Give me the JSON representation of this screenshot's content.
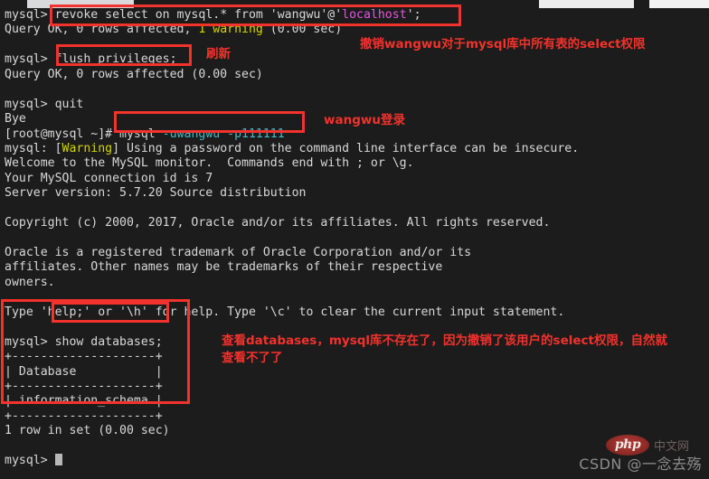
{
  "window": {
    "background_color": "#1c1c1c",
    "foreground_color": "#d6d6d6"
  },
  "terminal": {
    "prompt_mysql": "mysql> ",
    "prompt_shell": "[root@mysql ~]# ",
    "lines": [
      {
        "id": "l01",
        "prompt": "mysql> ",
        "segments": [
          {
            "text": "revoke select on mysql.* from 'wangwu'@'",
            "color": "white"
          },
          {
            "text": "localhost",
            "color": "magenta"
          },
          {
            "text": "';",
            "color": "white"
          }
        ]
      },
      {
        "id": "l02",
        "prompt": "",
        "segments": [
          {
            "text": "Query OK, 0 rows affected, ",
            "color": "white"
          },
          {
            "text": "1 warning",
            "color": "yellow"
          },
          {
            "text": " (0.00 sec)",
            "color": "white"
          }
        ]
      },
      {
        "id": "l03",
        "prompt": "",
        "segments": [
          {
            "text": "",
            "color": "white"
          }
        ]
      },
      {
        "id": "l04",
        "prompt": "mysql> ",
        "segments": [
          {
            "text": "flush privileges;",
            "color": "white"
          }
        ]
      },
      {
        "id": "l05",
        "prompt": "",
        "segments": [
          {
            "text": "Query OK, 0 rows affected (0.00 sec)",
            "color": "white"
          }
        ]
      },
      {
        "id": "l06",
        "prompt": "",
        "segments": [
          {
            "text": "",
            "color": "white"
          }
        ]
      },
      {
        "id": "l07",
        "prompt": "mysql> ",
        "segments": [
          {
            "text": "quit",
            "color": "white"
          }
        ]
      },
      {
        "id": "l08",
        "prompt": "",
        "segments": [
          {
            "text": "Bye",
            "color": "white"
          }
        ]
      },
      {
        "id": "l09",
        "prompt": "[root@mysql ~]# ",
        "segments": [
          {
            "text": "mysql ",
            "color": "white"
          },
          {
            "text": "-uwangwu -p111111",
            "color": "cyan"
          }
        ]
      },
      {
        "id": "l10",
        "prompt": "",
        "segments": [
          {
            "text": "mysql: [",
            "color": "white"
          },
          {
            "text": "Warning",
            "color": "yellow"
          },
          {
            "text": "] Using a password on the command line interface can be insecure.",
            "color": "white"
          }
        ]
      },
      {
        "id": "l11",
        "prompt": "",
        "segments": [
          {
            "text": "Welcome to the MySQL monitor.  Commands end with ; or \\g.",
            "color": "white"
          }
        ]
      },
      {
        "id": "l12",
        "prompt": "",
        "segments": [
          {
            "text": "Your MySQL connection id is 7",
            "color": "white"
          }
        ]
      },
      {
        "id": "l13",
        "prompt": "",
        "segments": [
          {
            "text": "Server version: 5.7.20 Source distribution",
            "color": "white"
          }
        ]
      },
      {
        "id": "l14",
        "prompt": "",
        "segments": [
          {
            "text": "",
            "color": "white"
          }
        ]
      },
      {
        "id": "l15",
        "prompt": "",
        "segments": [
          {
            "text": "Copyright (c) 2000, 2017, Oracle and/or its affiliates. All rights reserved.",
            "color": "white"
          }
        ]
      },
      {
        "id": "l16",
        "prompt": "",
        "segments": [
          {
            "text": "",
            "color": "white"
          }
        ]
      },
      {
        "id": "l17",
        "prompt": "",
        "segments": [
          {
            "text": "Oracle is a registered trademark of Oracle Corporation and/or its",
            "color": "white"
          }
        ]
      },
      {
        "id": "l18",
        "prompt": "",
        "segments": [
          {
            "text": "affiliates. Other names may be trademarks of their respective",
            "color": "white"
          }
        ]
      },
      {
        "id": "l19",
        "prompt": "",
        "segments": [
          {
            "text": "owners.",
            "color": "white"
          }
        ]
      },
      {
        "id": "l20",
        "prompt": "",
        "segments": [
          {
            "text": "",
            "color": "white"
          }
        ]
      },
      {
        "id": "l21",
        "prompt": "",
        "segments": [
          {
            "text": "Type 'help;' or '\\h' for help. Type '\\c' to clear the current input statement.",
            "color": "white"
          }
        ]
      },
      {
        "id": "l22",
        "prompt": "",
        "segments": [
          {
            "text": "",
            "color": "white"
          }
        ]
      },
      {
        "id": "l23",
        "prompt": "mysql> ",
        "segments": [
          {
            "text": "show databases;",
            "color": "white"
          }
        ]
      },
      {
        "id": "l24",
        "prompt": "",
        "segments": [
          {
            "text": "+--------------------+",
            "color": "white"
          }
        ]
      },
      {
        "id": "l25",
        "prompt": "",
        "segments": [
          {
            "text": "| Database           |",
            "color": "white"
          }
        ]
      },
      {
        "id": "l26",
        "prompt": "",
        "segments": [
          {
            "text": "+--------------------+",
            "color": "white"
          }
        ]
      },
      {
        "id": "l27",
        "prompt": "",
        "segments": [
          {
            "text": "| information_schema |",
            "color": "white"
          }
        ]
      },
      {
        "id": "l28",
        "prompt": "",
        "segments": [
          {
            "text": "+--------------------+",
            "color": "white"
          }
        ]
      },
      {
        "id": "l29",
        "prompt": "",
        "segments": [
          {
            "text": "1 row in set (0.00 sec)",
            "color": "white"
          }
        ]
      },
      {
        "id": "l30",
        "prompt": "",
        "segments": [
          {
            "text": "",
            "color": "white"
          }
        ]
      },
      {
        "id": "l31",
        "prompt": "mysql> ",
        "segments": [],
        "cursor": true
      }
    ],
    "result_table": {
      "columns": [
        "Database"
      ],
      "rows": [
        [
          "information_schema"
        ]
      ],
      "footer": "1 row in set (0.00 sec)"
    }
  },
  "annotations": {
    "color": "#f2322c",
    "notes": [
      {
        "id": "n1",
        "text": "撤销wangwu对于mysql库中所有表的select权限"
      },
      {
        "id": "n2",
        "text": "刷新"
      },
      {
        "id": "n3",
        "text": "wangwu登录"
      },
      {
        "id": "n4",
        "text": "查看databases，mysql库不存在了，因为撤销了该用户的select权限，自然就\n查看不了了"
      }
    ],
    "boxes": [
      {
        "id": "b1",
        "target": "revoke-statement"
      },
      {
        "id": "b2",
        "target": "flush-privileges-statement"
      },
      {
        "id": "b3",
        "target": "mysql-login-command"
      },
      {
        "id": "b4",
        "target": "show-databases-statement"
      },
      {
        "id": "b5",
        "target": "show-databases-result"
      }
    ]
  },
  "watermark": {
    "site": "CSDN @一念去殇",
    "logo_text": "php",
    "logo_cn": "中文网"
  }
}
